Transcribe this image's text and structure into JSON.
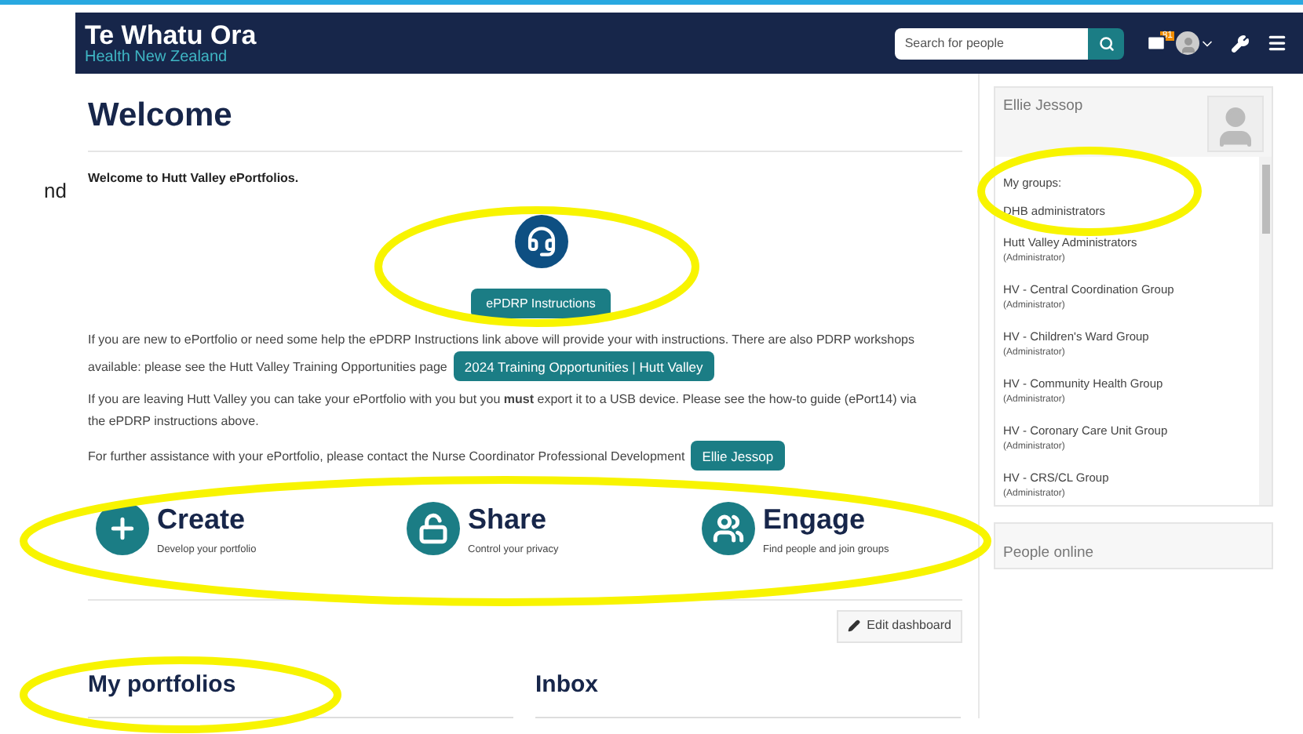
{
  "edge_fragment": "nd",
  "header": {
    "logo_title": "Te Whatu Ora",
    "logo_subtitle": "Health New Zealand",
    "search": {
      "placeholder": "Search for people"
    },
    "mail_badge": "81"
  },
  "welcome": {
    "title": "Welcome",
    "intro": "Welcome to Hutt Valley ePortfolios.",
    "instructions_button": "ePDRP Instructions",
    "paragraphs": [
      {
        "text": "If you are new to ePortfolio or need some help the ePDRP Instructions link above will provide your with instructions. There are also PDRP workshops available: please see the Hutt Valley Training Opportunities page",
        "button": "2024 Training Opportunities | Hutt Valley"
      },
      {
        "text": "If you are leaving Hutt Valley you can take your ePortfolio with you but you **must** export it to a USB device. Please see the how-to guide (ePort14) via the ePDRP instructions above."
      },
      {
        "text": "For further assistance with your ePortfolio, please contact the Nurse Coordinator Professional Development",
        "button": "Ellie Jessop"
      }
    ]
  },
  "features": [
    {
      "kind": "create",
      "title": "Create",
      "subtitle": "Develop your portfolio"
    },
    {
      "kind": "share",
      "title": "Share",
      "subtitle": "Control your privacy"
    },
    {
      "kind": "engage",
      "title": "Engage",
      "subtitle": "Find people and join groups"
    }
  ],
  "edit_dashboard": "Edit dashboard",
  "sections": [
    "My portfolios",
    "Inbox"
  ],
  "sidebar": {
    "user_name": "Ellie Jessop",
    "groups_label": "My groups:",
    "groups": [
      {
        "name": "DHB administrators"
      },
      {
        "name": "Hutt Valley Administrators",
        "role": "(Administrator)"
      },
      {
        "name": "HV - Central Coordination Group",
        "role": "(Administrator)"
      },
      {
        "name": "HV - Children's Ward Group",
        "role": "(Administrator)"
      },
      {
        "name": "HV - Community Health Group",
        "role": "(Administrator)"
      },
      {
        "name": "HV - Coronary Care Unit Group",
        "role": "(Administrator)"
      },
      {
        "name": "HV - CRS/CL Group",
        "role": "(Administrator)"
      }
    ],
    "people_online": "People online"
  }
}
